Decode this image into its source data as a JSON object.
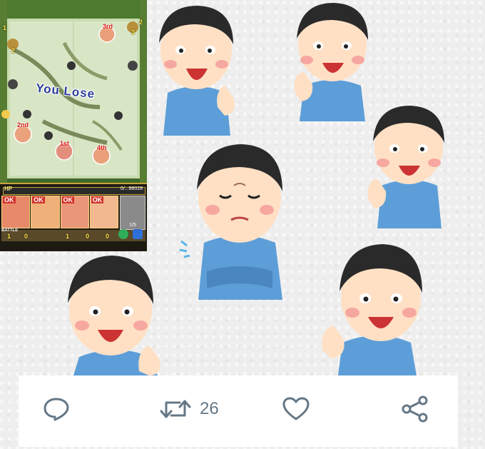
{
  "game": {
    "result_text": "You Lose",
    "hp_label": "HP",
    "hp_value": "0/...98028",
    "stage_count": "1/5",
    "ranks": [
      "3rd",
      "2nd",
      "4th",
      "1st"
    ],
    "corner_numbers": [
      "1",
      "2",
      "3",
      "2"
    ],
    "ok_badges": [
      "OK",
      "OK",
      "OK",
      "OK"
    ],
    "battle_label": "BATTLE",
    "counters": [
      "1",
      "0",
      "1",
      "0",
      "0"
    ]
  },
  "actions": {
    "reply_icon": "reply-icon",
    "retweet_icon": "retweet-icon",
    "retweet_count": "26",
    "like_icon": "heart-icon",
    "share_icon": "share-icon"
  },
  "colors": {
    "action_gray": "#657786",
    "shirt_blue": "#5d9ed8",
    "skin": "#ffe0c4",
    "hair": "#2a2a2a"
  }
}
